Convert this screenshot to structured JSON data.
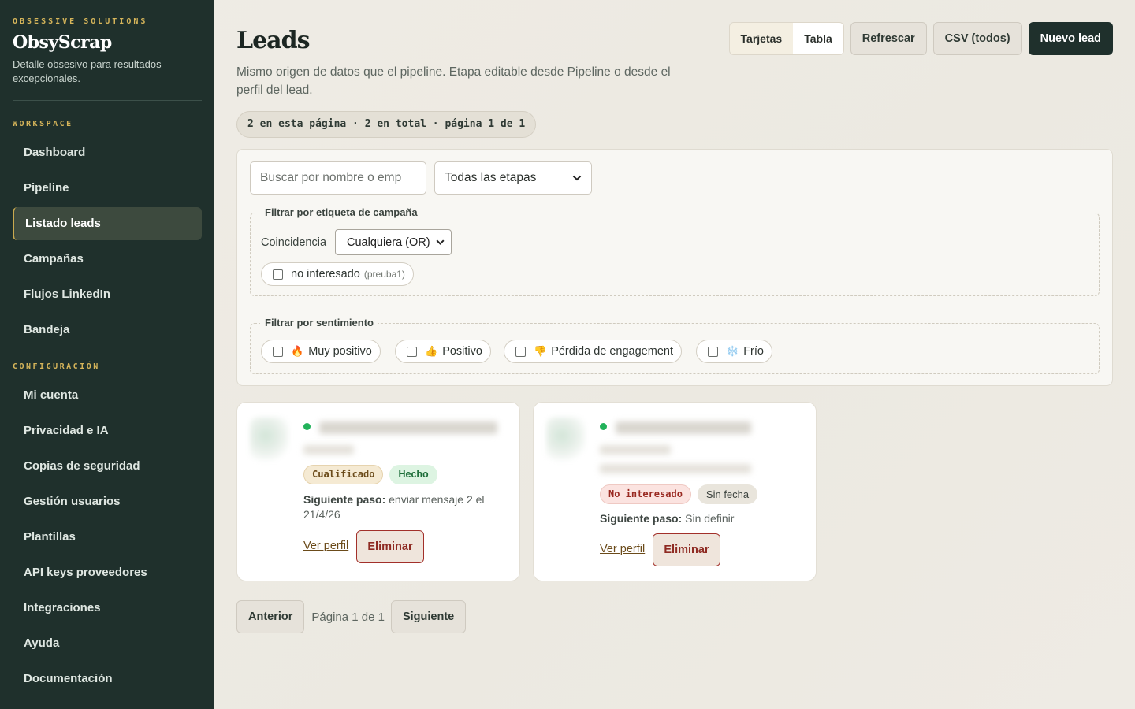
{
  "brand": {
    "kicker": "OBSESSIVE SOLUTIONS",
    "name": "ObsyScrap",
    "tagline": "Detalle obsesivo para resultados excepcionales."
  },
  "sidebar": {
    "workspace_label": "WORKSPACE",
    "workspace_items": [
      {
        "label": "Dashboard"
      },
      {
        "label": "Pipeline"
      },
      {
        "label": "Listado leads",
        "active": true
      },
      {
        "label": "Campañas"
      },
      {
        "label": "Flujos LinkedIn"
      },
      {
        "label": "Bandeja"
      }
    ],
    "config_label": "CONFIGURACIÓN",
    "config_items": [
      {
        "label": "Mi cuenta"
      },
      {
        "label": "Privacidad e IA"
      },
      {
        "label": "Copias de seguridad"
      },
      {
        "label": "Gestión usuarios"
      },
      {
        "label": "Plantillas"
      },
      {
        "label": "API keys proveedores"
      },
      {
        "label": "Integraciones"
      },
      {
        "label": "Ayuda"
      },
      {
        "label": "Documentación"
      }
    ]
  },
  "header": {
    "title": "Leads",
    "description": "Mismo origen de datos que el pipeline. Etapa editable desde Pipeline o desde el perfil del lead.",
    "count_summary": "2 en esta página · 2 en total · página 1 de 1"
  },
  "toolbar": {
    "view_cards": "Tarjetas",
    "view_table": "Tabla",
    "refresh": "Refrescar",
    "csv": "CSV (todos)",
    "new_lead": "Nuevo lead"
  },
  "filters": {
    "search_placeholder": "Buscar por nombre o emp",
    "stage_selected": "Todas las etapas",
    "campaign_legend": "Filtrar por etiqueta de campaña",
    "match_label": "Coincidencia",
    "match_selected": "Cualquiera (OR)",
    "campaign_tags": [
      {
        "label": "no interesado",
        "sub": "(preuba1)"
      }
    ],
    "sentiment_legend": "Filtrar por sentimiento",
    "sentiments": [
      {
        "emoji": "🔥",
        "label": "Muy positivo"
      },
      {
        "emoji": "👍",
        "label": "Positivo"
      },
      {
        "emoji": "👎",
        "label": "Pérdida de engagement"
      },
      {
        "emoji": "❄️",
        "label": "Frío"
      }
    ]
  },
  "cards": [
    {
      "stage": "Cualificado",
      "status": "Hecho",
      "next_step_label": "Siguiente paso:",
      "next_step_value": "enviar mensaje 2 el 21/4/26",
      "view_profile": "Ver perfil",
      "delete": "Eliminar"
    },
    {
      "stage": "No interesado",
      "status": "Sin fecha",
      "next_step_label": "Siguiente paso:",
      "next_step_value": "Sin definir",
      "view_profile": "Ver perfil",
      "delete": "Eliminar"
    }
  ],
  "pager": {
    "prev": "Anterior",
    "info": "Página 1 de 1",
    "next": "Siguiente"
  },
  "colors": {
    "sidebar_bg": "#1f302c",
    "accent_gold": "#d6b55a",
    "status_online": "#22b25a",
    "danger": "#8e2a22"
  }
}
